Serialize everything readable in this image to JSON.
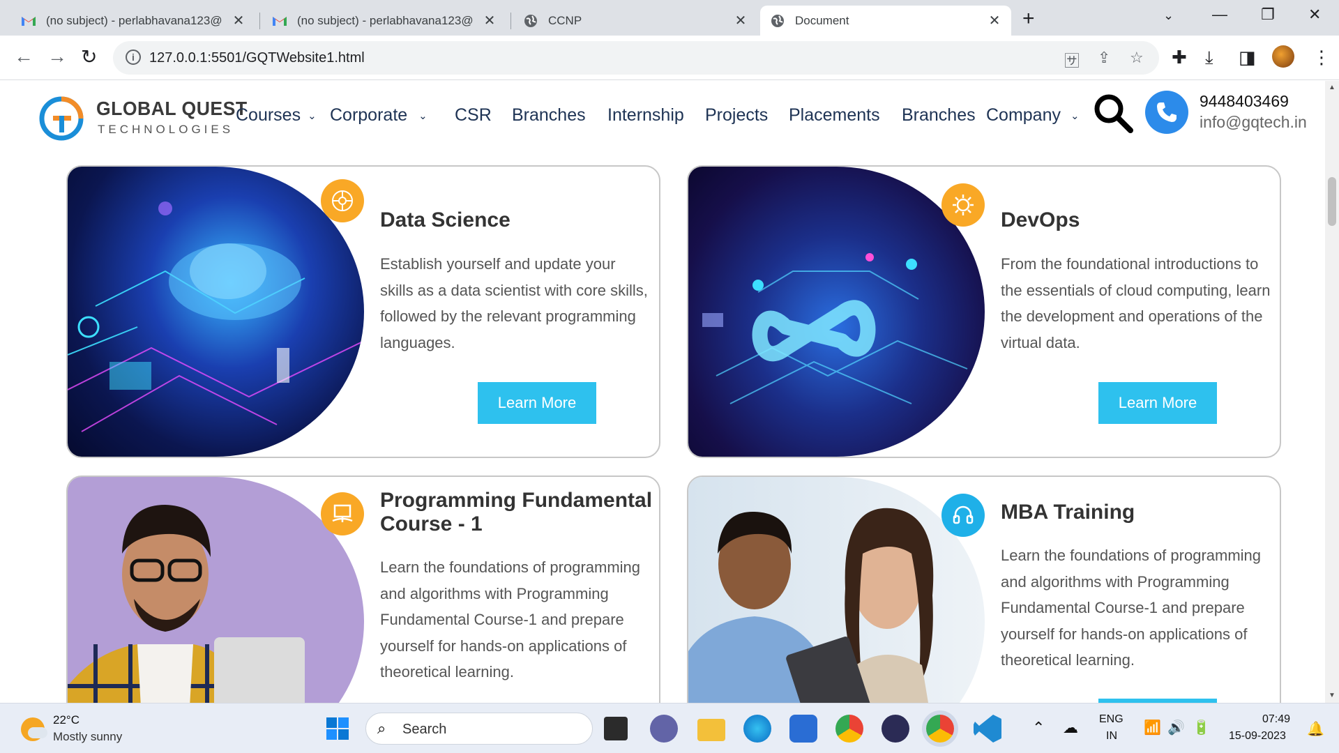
{
  "browser": {
    "tabs": [
      {
        "title": "(no subject) - perlabhavana123@",
        "icon": "gmail-icon"
      },
      {
        "title": "(no subject) - perlabhavana123@",
        "icon": "gmail-icon"
      },
      {
        "title": "CCNP",
        "icon": "globe-icon"
      },
      {
        "title": "Document",
        "icon": "globe-icon",
        "active": true
      }
    ],
    "url": "127.0.0.1:5501/GQTWebsite1.html"
  },
  "site": {
    "logo_line1": "GLOBAL QUEST",
    "logo_line2": "TECHNOLOGIES",
    "menu": [
      {
        "label": "Courses",
        "dropdown": true
      },
      {
        "label": "Corporate",
        "dropdown": true
      },
      {
        "label": "CSR",
        "dropdown": false
      },
      {
        "label": "Branches",
        "dropdown": false
      },
      {
        "label": "Internship",
        "dropdown": false
      },
      {
        "label": "Projects",
        "dropdown": false
      },
      {
        "label": "Placements",
        "dropdown": false
      },
      {
        "label": "Branches",
        "dropdown": false
      },
      {
        "label": "Company",
        "dropdown": true
      }
    ],
    "phone": "9448403469",
    "email": "info@gqtech.in"
  },
  "cards": [
    {
      "title": "Data Science",
      "desc": [
        "Establish yourself and update your",
        "skills as a data scientist with core skills,",
        "followed by the relevant programming",
        "languages."
      ],
      "button": "Learn More",
      "badge_color": "#f9a826"
    },
    {
      "title": "DevOps",
      "desc": [
        "From the foundational introductions to",
        "the essentials of cloud computing, learn",
        "the development and operations of the",
        "virtual data."
      ],
      "button": "Learn More",
      "badge_color": "#f9a826"
    },
    {
      "title": [
        "Programming Fundamental",
        "Course - 1"
      ],
      "desc": [
        "Learn the foundations of programming",
        "and algorithms with Programming",
        "Fundamental Course-1 and prepare",
        "yourself for hands-on applications of",
        "theoretical learning."
      ],
      "badge_color": "#f9a826"
    },
    {
      "title": "MBA Training",
      "desc": [
        "Learn the foundations of programming",
        "and algorithms with Programming",
        "Fundamental Course-1 and prepare",
        "yourself for hands-on applications of",
        "theoretical learning."
      ],
      "badge_color": "#1fb0e8"
    }
  ],
  "taskbar": {
    "weather_temp": "22°C",
    "weather_desc": "Mostly sunny",
    "search_placeholder": "Search",
    "lang1": "ENG",
    "lang2": "IN",
    "time": "07:49",
    "date": "15-09-2023"
  }
}
